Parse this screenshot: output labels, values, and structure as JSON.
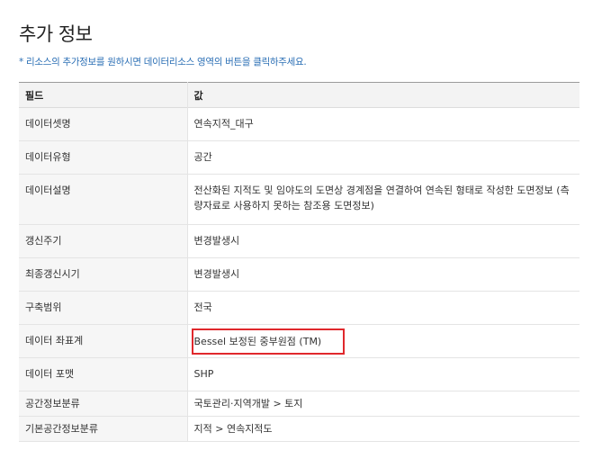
{
  "page": {
    "title": "추가 정보",
    "note": "* 리소스의 추가정보를 원하시면 데이터리소스 영역의 버튼을 클릭하주세요."
  },
  "table": {
    "headers": [
      "필드",
      "값"
    ],
    "rows": [
      {
        "field": "데이터셋명",
        "value": "연속지적_대구"
      },
      {
        "field": "데이터유형",
        "value": "공간"
      },
      {
        "field": "데이터설명",
        "value": "전산화된 지적도 및 임야도의 도면상 경계점을 연결하여 연속된 형태로 작성한 도면정보 (측량자료로 사용하지 못하는 참조용 도면정보)"
      },
      {
        "field": "갱신주기",
        "value": "변경발생시"
      },
      {
        "field": "최종갱신시기",
        "value": "변경발생시"
      },
      {
        "field": "구축범위",
        "value": "전국"
      },
      {
        "field": "데이터 좌표계",
        "value": "Bessel 보정된 중부원점 (TM)"
      },
      {
        "field": "데이터 포맷",
        "value": "SHP"
      },
      {
        "field": "공간정보분류",
        "value": "국토관리·지역개발 > 토지"
      },
      {
        "field": "기본공간정보분류",
        "value": "지적 > 연속지적도"
      }
    ]
  },
  "colors": {
    "highlight": "#e0282c",
    "note": "#2b6fb5"
  }
}
